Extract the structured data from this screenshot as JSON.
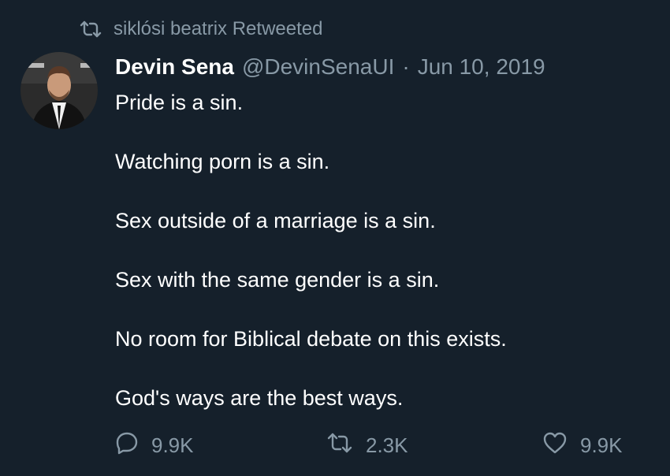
{
  "retweet_context": {
    "icon": "retweet-icon",
    "text": "siklósi beatrix Retweeted"
  },
  "tweet": {
    "avatar": "avatar-photo",
    "display_name": "Devin Sena",
    "handle": "@DevinSenaUI",
    "separator": "·",
    "date": "Jun 10, 2019",
    "lines": [
      "Pride is a sin.",
      "Watching porn is a sin.",
      "Sex outside of a marriage is a sin.",
      "Sex with the same gender is a sin.",
      "No room for Biblical debate on this exists.",
      "God's ways are the best ways."
    ]
  },
  "actions": {
    "reply": {
      "icon": "reply-icon",
      "count": "9.9K"
    },
    "retweet": {
      "icon": "retweet-icon",
      "count": "2.3K"
    },
    "like": {
      "icon": "heart-icon",
      "count": "9.9K"
    }
  },
  "colors": {
    "background": "#15202b",
    "text": "#ffffff",
    "secondary": "#8899a6"
  }
}
